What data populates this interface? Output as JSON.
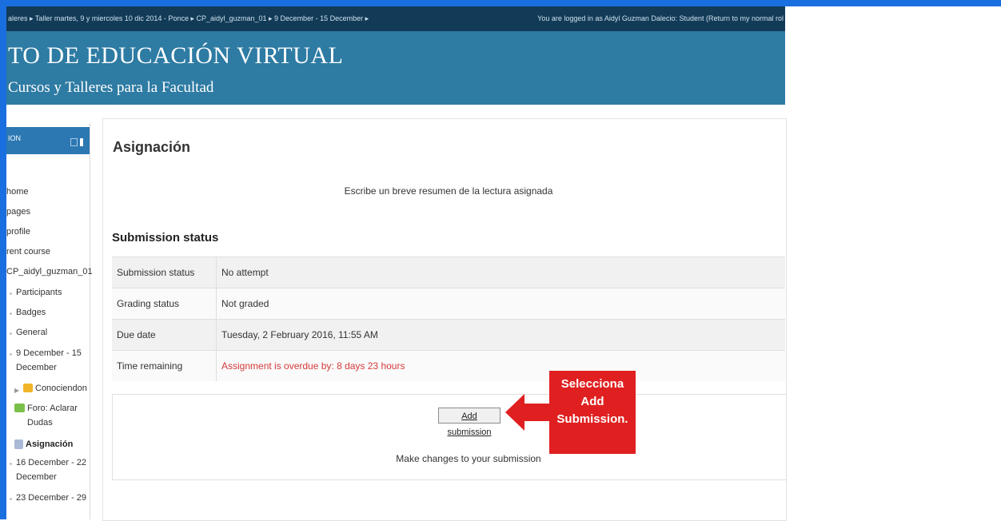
{
  "navbar": {
    "breadcrumb": "aleres ▸ Taller martes, 9 y miercoles 10 dic 2014 - Ponce ▸ CP_aidyl_guzman_01 ▸ 9 December - 15 December ▸",
    "login_text": "You are logged in as Aidyl Guzman Dalecio: Student (Return to my normal rol"
  },
  "header": {
    "title": "TO DE EDUCACIÓN VIRTUAL",
    "subtitle": "Cursos y Talleres para la Facultad"
  },
  "sidebar": {
    "heading": "ION",
    "items": [
      {
        "label": "home"
      },
      {
        "label": "pages"
      },
      {
        "label": "profile"
      },
      {
        "label": "rent course"
      },
      {
        "label": "CP_aidyl_guzman_01"
      },
      {
        "label": "Participants"
      },
      {
        "label": "Badges"
      },
      {
        "label": "General"
      },
      {
        "label": "9 December - 15"
      },
      {
        "label": "December"
      },
      {
        "label": "Conociendon"
      },
      {
        "label": "Foro: Aclarar"
      },
      {
        "label": "Dudas"
      },
      {
        "label": "Asignación"
      },
      {
        "label": "16 December - 22"
      },
      {
        "label": "December"
      },
      {
        "label": "23 December - 29"
      }
    ]
  },
  "main": {
    "heading": "Asignación",
    "intro": "Escribe un breve resumen de la lectura asignada",
    "submission_heading": "Submission status",
    "rows": [
      {
        "label": "Submission status",
        "value": "No attempt"
      },
      {
        "label": "Grading status",
        "value": "Not graded"
      },
      {
        "label": "Due date",
        "value": "Tuesday, 2 February 2016, 11:55 AM"
      },
      {
        "label": "Time remaining",
        "value": "Assignment is overdue by: 8 days 23 hours"
      }
    ],
    "add_submission": "Add submission",
    "make_changes": "Make changes to your submission"
  },
  "callout": {
    "line1": "Selecciona",
    "line2": "Add",
    "line3": "Submission."
  },
  "colors": {
    "navbar": "#123b57",
    "header": "#2e7ba3",
    "frame": "#1a6fe0",
    "overdue": "#d63a3a",
    "callout": "#e02020"
  }
}
